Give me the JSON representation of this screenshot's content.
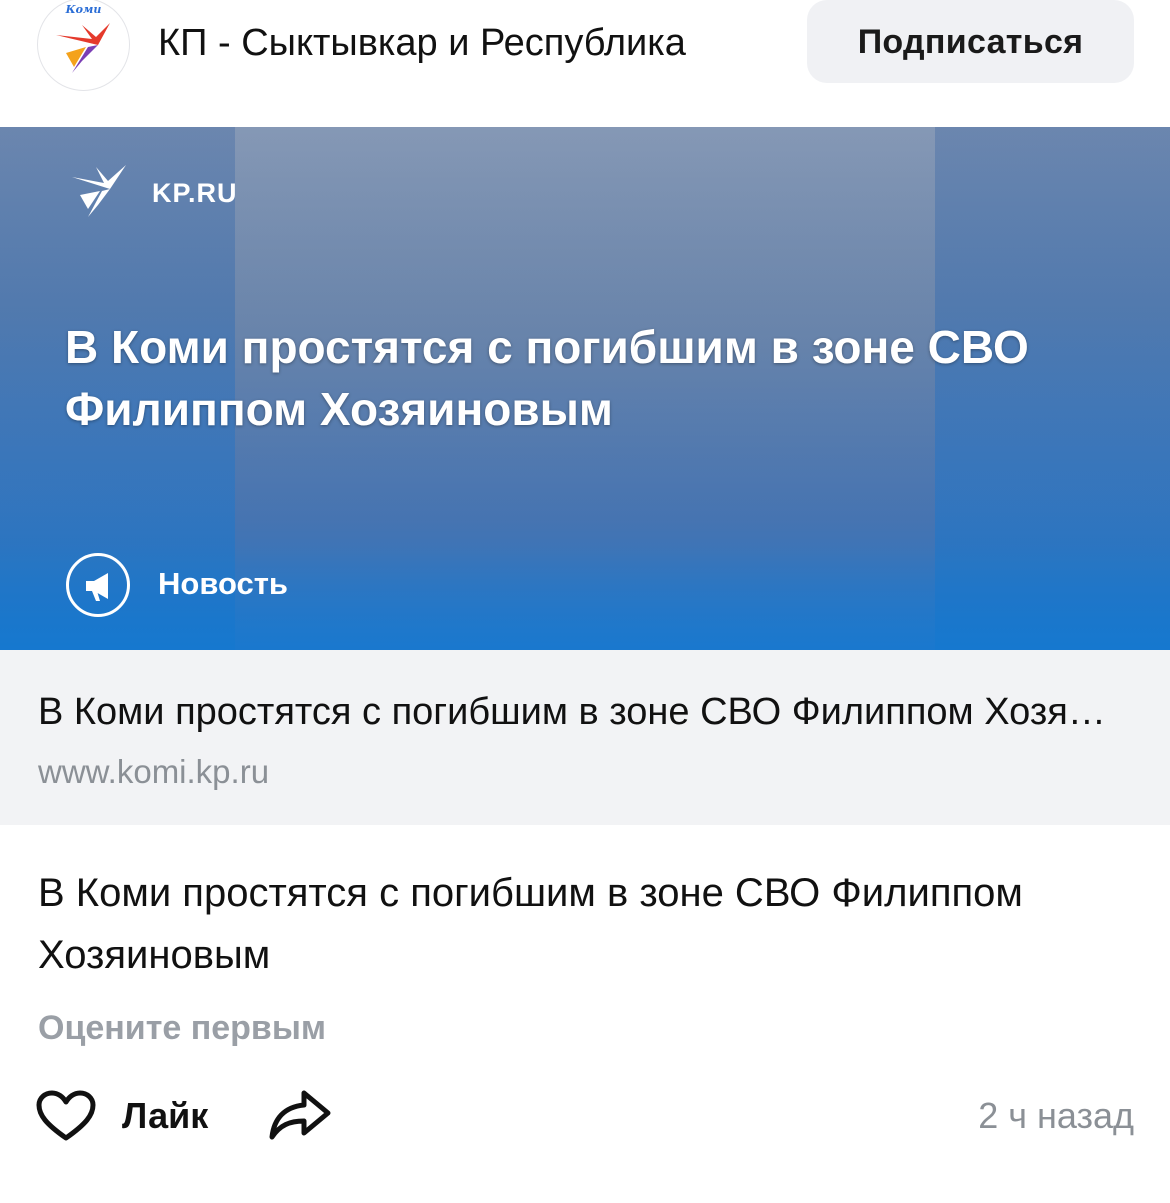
{
  "header": {
    "channel_name": "КП - Сыктывкар и Республика",
    "avatar_caption": "Коми",
    "subscribe_label": "Подписаться"
  },
  "hero": {
    "brand": "KP.RU",
    "headline": "В Коми простятся с погибшим в зоне СВО Филиппом Хозяиновым",
    "category": "Новость"
  },
  "link_preview": {
    "title": "В Коми простятся с погибшим в зоне СВО Филиппом Хозяиновым",
    "url": "www.komi.kp.ru"
  },
  "post": {
    "text": "В Коми простятся с погибшим в зоне СВО Филиппом Хозяиновым",
    "rate_prompt": "Оцените первым"
  },
  "actions": {
    "like_label": "Лайк",
    "timestamp": "2 ч назад"
  },
  "icons": {
    "like": "heart-icon",
    "share": "share-arrow-icon",
    "news": "megaphone-icon",
    "brand": "bird-logo-icon"
  },
  "colors": {
    "subscribe_bg": "#f0f1f4",
    "link_box_bg": "#f2f3f5",
    "muted_text": "#8b9096",
    "hero_blue": "#1b78c6"
  }
}
